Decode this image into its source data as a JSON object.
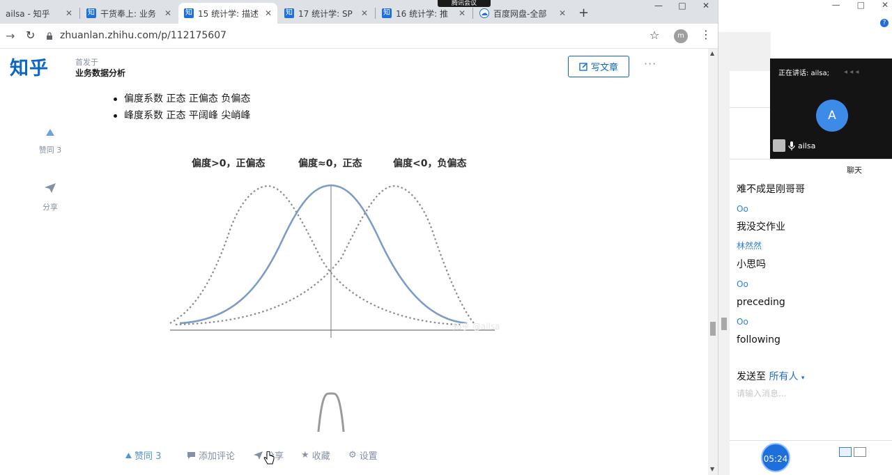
{
  "browser": {
    "tabs": [
      {
        "label": "ailsa - 知乎",
        "favicon": "知"
      },
      {
        "label": "干货奉上: 业务",
        "favicon": "知"
      },
      {
        "label": "15 统计学: 描述",
        "favicon": "知"
      },
      {
        "label": "17 统计学: SP",
        "favicon": "知"
      },
      {
        "label": "16 统计学: 推",
        "favicon": "知"
      },
      {
        "label": "百度网盘-全部",
        "favicon": "cloud"
      }
    ],
    "active_tab_index": 2,
    "new_tab": "+",
    "meeting_tag": "腾讯会议",
    "window_controls": {
      "minimize": "—",
      "maximize": "□",
      "close": "✕"
    },
    "url": "zhuanlan.zhihu.com/p/112175607",
    "profile_initial": "m"
  },
  "page": {
    "logo": "知乎",
    "published_prefix": "首发于",
    "column_name": "业务数据分析",
    "write_button": "写文章",
    "more": "···",
    "bullets": [
      "偏度系数 正态 正偏态 负偏态",
      "峰度系数 正态 平阔峰 尖峭峰"
    ],
    "side_actions": {
      "like": "赞同 3",
      "share": "分享"
    },
    "figure_labels": [
      "偏度>0，正偏态",
      "偏度≈0，正态",
      "偏度<0，负偏态"
    ],
    "watermark": "知乎 @ailsa",
    "bottom_bar": {
      "like": "赞同 3",
      "comment": "添加评论",
      "share": "分享",
      "favorite": "收藏",
      "settings": "设置"
    }
  },
  "meeting": {
    "speaking_label": "正在讲话: ailsa;",
    "speaker_initial": "A",
    "speaker_name": "ailsa",
    "chat_title": "聊天",
    "messages": [
      {
        "type": "text",
        "text": "难不成是刚哥哥"
      },
      {
        "type": "name",
        "text": "Oo"
      },
      {
        "type": "text",
        "text": "我没交作业"
      },
      {
        "type": "name",
        "text": "林然然"
      },
      {
        "type": "text",
        "text": "小思吗"
      },
      {
        "type": "name",
        "text": "Oo"
      },
      {
        "type": "text",
        "text": "preceding"
      },
      {
        "type": "name",
        "text": "Oo"
      },
      {
        "type": "text",
        "text": "following"
      }
    ],
    "send_to_label": "发送至",
    "send_to_target": "所有人",
    "input_placeholder": "请输入消息...",
    "timer": "05:24"
  },
  "colors": {
    "zhihu_blue": "#0a66c2",
    "curve_solid": "#7a9cc6",
    "curve_dotted": "#8a8a8a",
    "meeting_blue": "#1e6fdc"
  }
}
